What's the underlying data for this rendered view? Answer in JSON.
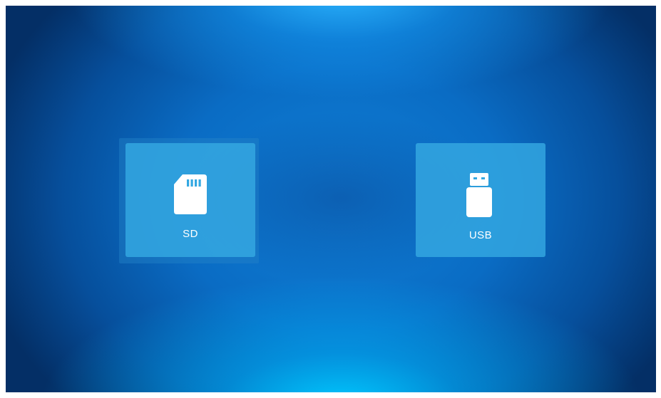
{
  "sources": [
    {
      "id": "sd",
      "label": "SD",
      "icon": "sd-card-icon",
      "selected": true
    },
    {
      "id": "usb",
      "label": "USB",
      "icon": "usb-drive-icon",
      "selected": false
    }
  ],
  "colors": {
    "tile": "#34a8e2",
    "tile_label": "#ffffff",
    "background_center": "#0f7fd6",
    "background_edge": "#042f66",
    "background_glow": "#00c8ff"
  }
}
